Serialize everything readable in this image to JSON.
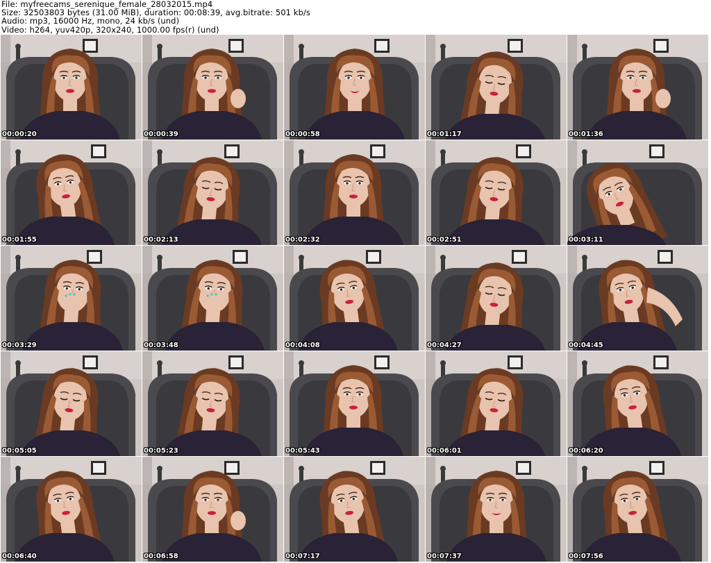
{
  "header": {
    "file": "File: myfreecams_serenique_female_28032015.mp4",
    "size": "Size: 32503803 bytes (31.00 MiB), duration: 00:08:39, avg.bitrate: 501 kb/s",
    "audio": "Audio: mp3, 16000 Hz, mono, 24 kb/s (und)",
    "video": "Video: h264, yuv420p, 320x240, 1000.00 fps(r) (und)"
  },
  "frames": [
    {
      "timestamp": "00:00:20",
      "pose": "front"
    },
    {
      "timestamp": "00:00:39",
      "pose": "hand-hair"
    },
    {
      "timestamp": "00:00:58",
      "pose": "front-smile"
    },
    {
      "timestamp": "00:01:17",
      "pose": "look-down"
    },
    {
      "timestamp": "00:01:36",
      "pose": "hand-hair"
    },
    {
      "timestamp": "00:01:55",
      "pose": "side"
    },
    {
      "timestamp": "00:02:13",
      "pose": "look-down"
    },
    {
      "timestamp": "00:02:32",
      "pose": "front"
    },
    {
      "timestamp": "00:02:51",
      "pose": "look-down"
    },
    {
      "timestamp": "00:03:11",
      "pose": "lean"
    },
    {
      "timestamp": "00:03:29",
      "pose": "hand-face"
    },
    {
      "timestamp": "00:03:48",
      "pose": "hand-face"
    },
    {
      "timestamp": "00:04:08",
      "pose": "side"
    },
    {
      "timestamp": "00:04:27",
      "pose": "look-down"
    },
    {
      "timestamp": "00:04:45",
      "pose": "hand-neck"
    },
    {
      "timestamp": "00:05:05",
      "pose": "look-down"
    },
    {
      "timestamp": "00:05:23",
      "pose": "look-down"
    },
    {
      "timestamp": "00:05:43",
      "pose": "front"
    },
    {
      "timestamp": "00:06:01",
      "pose": "look-down"
    },
    {
      "timestamp": "00:06:20",
      "pose": "side"
    },
    {
      "timestamp": "00:06:40",
      "pose": "side"
    },
    {
      "timestamp": "00:06:58",
      "pose": "hand-hair"
    },
    {
      "timestamp": "00:07:17",
      "pose": "side"
    },
    {
      "timestamp": "00:07:37",
      "pose": "front-smile"
    },
    {
      "timestamp": "00:07:56",
      "pose": "side"
    }
  ],
  "colors": {
    "wall": "#cfc7c3",
    "wall_shadow": "#a79f9c",
    "chair": "#4a4a4e",
    "chair_dark": "#2e2e32",
    "hair": "#6a3a22",
    "hair_light": "#9a5a34",
    "skin": "#e8c3ad",
    "shirt": "#2a2236",
    "lips": "#c8203a",
    "frame": "#2b2b2b",
    "timestamp": "#ffffff"
  }
}
